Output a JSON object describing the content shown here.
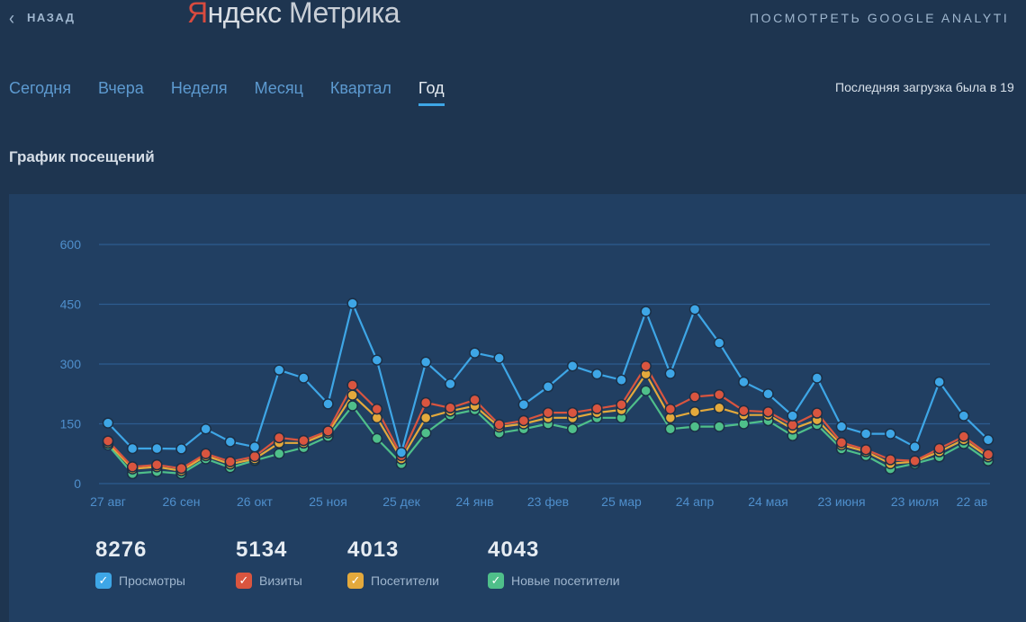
{
  "header": {
    "back_label": "НАЗАД",
    "logo_part1": "Я",
    "logo_part2": "ндекс",
    "logo_part3": " Метрика",
    "ga_link": "ПОСМОТРЕТЬ GOOGLE ANALYTI"
  },
  "tabs": [
    {
      "label": "Сегодня",
      "active": false
    },
    {
      "label": "Вчера",
      "active": false
    },
    {
      "label": "Неделя",
      "active": false
    },
    {
      "label": "Месяц",
      "active": false
    },
    {
      "label": "Квартал",
      "active": false
    },
    {
      "label": "Год",
      "active": true
    }
  ],
  "last_load": "Последняя загрузка была в 19",
  "section_title": "График посещений",
  "colors": {
    "views": "#3ea6e6",
    "visits": "#d9553f",
    "visitors": "#e3a93c",
    "new_visitors": "#4fbf8a"
  },
  "chart_data": {
    "type": "line",
    "title": "",
    "xlabel": "",
    "ylabel": "",
    "ylim": [
      0,
      600
    ],
    "yticks": [
      0,
      150,
      300,
      450,
      600
    ],
    "grid": true,
    "xtick_labels": [
      "27 авг",
      "26 сен",
      "26 окт",
      "25 ноя",
      "25 дек",
      "24 янв",
      "23 фев",
      "25 мар",
      "24 апр",
      "24 мая",
      "23 июня",
      "23 июля",
      "22 ав"
    ],
    "xtick_indices": [
      0,
      3,
      6,
      9,
      12,
      15,
      18,
      21,
      24,
      27,
      30,
      33,
      36
    ],
    "series": [
      {
        "name": "Просмотры",
        "color": "#3ea6e6",
        "values": [
          152,
          88,
          88,
          87,
          137,
          105,
          92,
          285,
          265,
          200,
          452,
          310,
          78,
          305,
          250,
          328,
          315,
          198,
          243,
          295,
          275,
          260,
          432,
          276,
          437,
          353,
          255,
          225,
          170,
          265,
          143,
          125,
          125,
          92,
          255,
          170,
          110
        ]
      },
      {
        "name": "Визиты",
        "color": "#d9553f",
        "values": [
          107,
          42,
          47,
          38,
          75,
          55,
          68,
          115,
          108,
          132,
          247,
          187,
          70,
          203,
          190,
          210,
          148,
          158,
          178,
          178,
          188,
          198,
          295,
          187,
          218,
          223,
          183,
          180,
          147,
          177,
          103,
          85,
          60,
          57,
          88,
          118,
          73
        ]
      },
      {
        "name": "Посетители",
        "color": "#e3a93c",
        "values": [
          102,
          37,
          42,
          32,
          70,
          49,
          62,
          102,
          102,
          127,
          222,
          165,
          62,
          165,
          182,
          195,
          142,
          150,
          165,
          165,
          178,
          185,
          275,
          165,
          180,
          190,
          172,
          172,
          137,
          160,
          97,
          80,
          50,
          55,
          80,
          110,
          67
        ]
      },
      {
        "name": "Новые посетители",
        "color": "#4fbf8a",
        "values": [
          97,
          25,
          30,
          25,
          62,
          40,
          58,
          75,
          90,
          118,
          195,
          113,
          50,
          127,
          172,
          185,
          127,
          137,
          150,
          137,
          165,
          165,
          233,
          137,
          143,
          143,
          150,
          158,
          120,
          148,
          87,
          70,
          37,
          50,
          67,
          100,
          57
        ]
      }
    ]
  },
  "totals": [
    {
      "value": "8276",
      "label": "Просмотры",
      "color": "#3ea6e6"
    },
    {
      "value": "5134",
      "label": "Визиты",
      "color": "#d9553f"
    },
    {
      "value": "4013",
      "label": "Посетители",
      "color": "#e3a93c"
    },
    {
      "value": "4043",
      "label": "Новые посетители",
      "color": "#4fbf8a"
    }
  ]
}
